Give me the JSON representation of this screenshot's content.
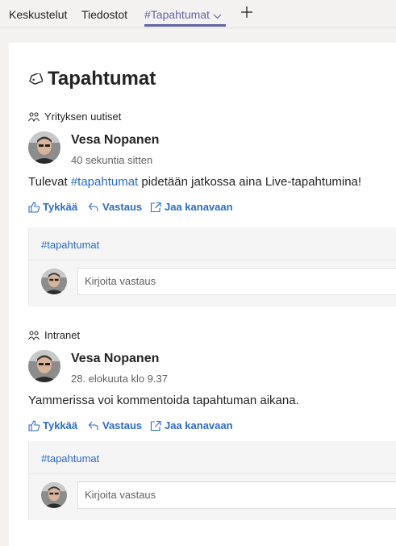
{
  "tabs": [
    {
      "label": "Keskustelut"
    },
    {
      "label": "Tiedostot"
    },
    {
      "label": "#Tapahtumat"
    }
  ],
  "page": {
    "title": "Tapahtumat"
  },
  "threads": [
    {
      "group": "Yrityksen uutiset",
      "author": "Vesa Nopanen",
      "time": "40 sekuntia sitten",
      "body_before": "Tulevat ",
      "body_hashtag": "#tapahtumat",
      "body_after": " pidetään jatkossa aina Live-tapahtumina!",
      "actions": {
        "like": "Tykkää",
        "reply": "Vastaus",
        "share": "Jaa kanavaan"
      },
      "topic": "#tapahtumat",
      "reply_placeholder": "Kirjoita vastaus"
    },
    {
      "group": "Intranet",
      "author": "Vesa Nopanen",
      "time": "28. elokuuta klo 9.37",
      "body": "Yammerissa voi kommentoida tapahtuman aikana.",
      "actions": {
        "like": "Tykkää",
        "reply": "Vastaus",
        "share": "Jaa kanavaan"
      },
      "topic": "#tapahtumat",
      "reply_placeholder": "Kirjoita vastaus"
    }
  ],
  "colors": {
    "accent": "#6264a7",
    "link": "#2b6cc4",
    "background": "#f3f2f1"
  }
}
